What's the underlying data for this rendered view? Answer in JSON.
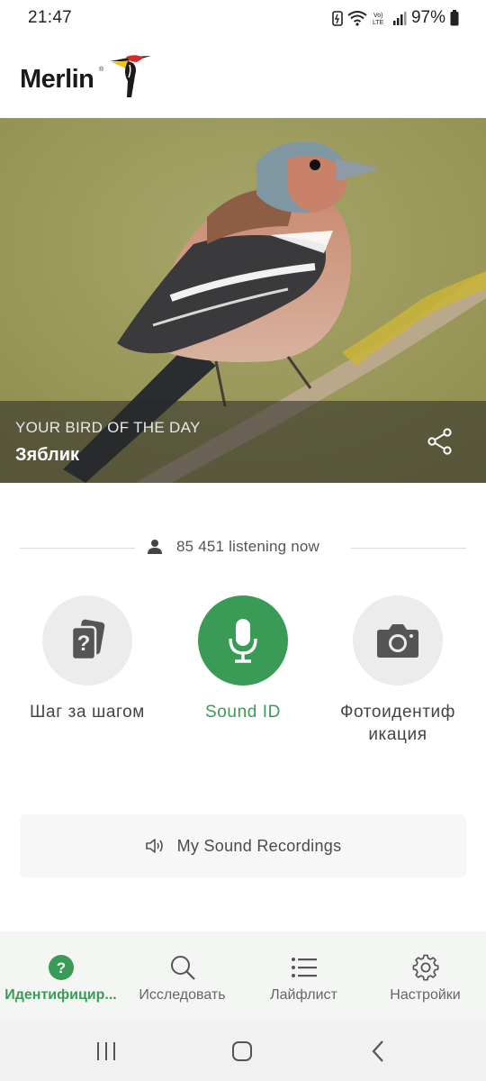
{
  "status_bar": {
    "time": "21:47",
    "battery": "97%",
    "icons": [
      "battery-saver-icon",
      "wifi-icon",
      "volte-icon",
      "signal-icon",
      "battery-icon"
    ]
  },
  "header": {
    "logo_text": "Merlin",
    "logo_mark": "®"
  },
  "bird_of_day": {
    "kicker": "YOUR BIRD OF THE DAY",
    "name": "Зяблик"
  },
  "listening": {
    "text": "85 451 listening now"
  },
  "actions": [
    {
      "label": "Шаг за шагом",
      "icon": "question-cards-icon"
    },
    {
      "label": "Sound ID",
      "icon": "microphone-icon"
    },
    {
      "label": "Фотоидентиф икация",
      "icon": "camera-icon"
    }
  ],
  "recordings": {
    "label": "My Sound Recordings"
  },
  "bottom_nav": [
    {
      "label": "Идентифицир...",
      "icon": "help-circle-icon",
      "active": true
    },
    {
      "label": "Исследовать",
      "icon": "search-icon",
      "active": false
    },
    {
      "label": "Лайфлист",
      "icon": "list-icon",
      "active": false
    },
    {
      "label": "Настройки",
      "icon": "gear-icon",
      "active": false
    }
  ],
  "colors": {
    "accent": "#3a9b57",
    "nav_background": "#f4f6f4"
  }
}
